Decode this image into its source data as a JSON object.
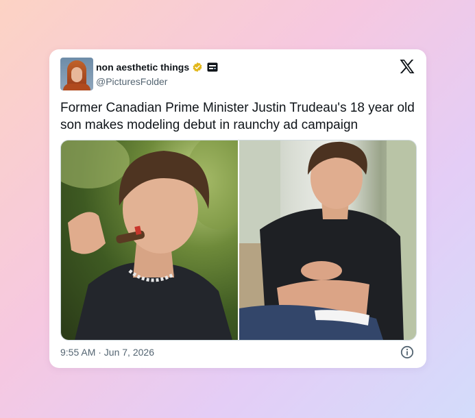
{
  "tweet": {
    "display_name": "non aesthetic things",
    "handle": "@PicturesFolder",
    "text": "Former Canadian Prime Minister Justin Trudeau's 18 year old son makes modeling debut in raunchy ad campaign",
    "timestamp": "9:55 AM · Jun 7, 2026",
    "badges": [
      "verified-badge-icon",
      "affiliate-badge-icon"
    ],
    "media_count": 2
  },
  "icons": {
    "logo": "x-logo-icon",
    "info": "info-icon"
  },
  "colors": {
    "verified_gold": "#e2b719",
    "text_primary": "#0f1419",
    "text_secondary": "#536471"
  }
}
